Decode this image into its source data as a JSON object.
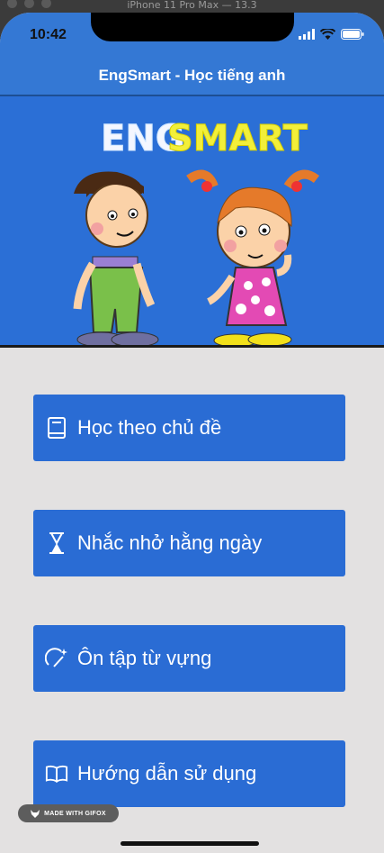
{
  "window": {
    "title": "iPhone 11 Pro Max — 13.3"
  },
  "status_bar": {
    "time": "10:42"
  },
  "app": {
    "title": "EngSmart - Học tiếng anh"
  },
  "banner": {
    "logo_text_a": "ENG",
    "logo_text_b": "SMART"
  },
  "menu": [
    {
      "label": "Học theo chủ đề",
      "icon": "book-cover-icon"
    },
    {
      "label": "Nhắc nhở hằng ngày",
      "icon": "hourglass-icon"
    },
    {
      "label": "Ôn tập từ vựng",
      "icon": "magic-wand-icon"
    },
    {
      "label": "Hướng dẫn sử dụng",
      "icon": "open-book-icon"
    }
  ],
  "badge": {
    "text": "MADE WITH GIFOX"
  },
  "colors": {
    "header": "#3478d4",
    "banner": "#2b6fd6",
    "button": "#2a6cd4",
    "background": "#e3e1e1"
  }
}
